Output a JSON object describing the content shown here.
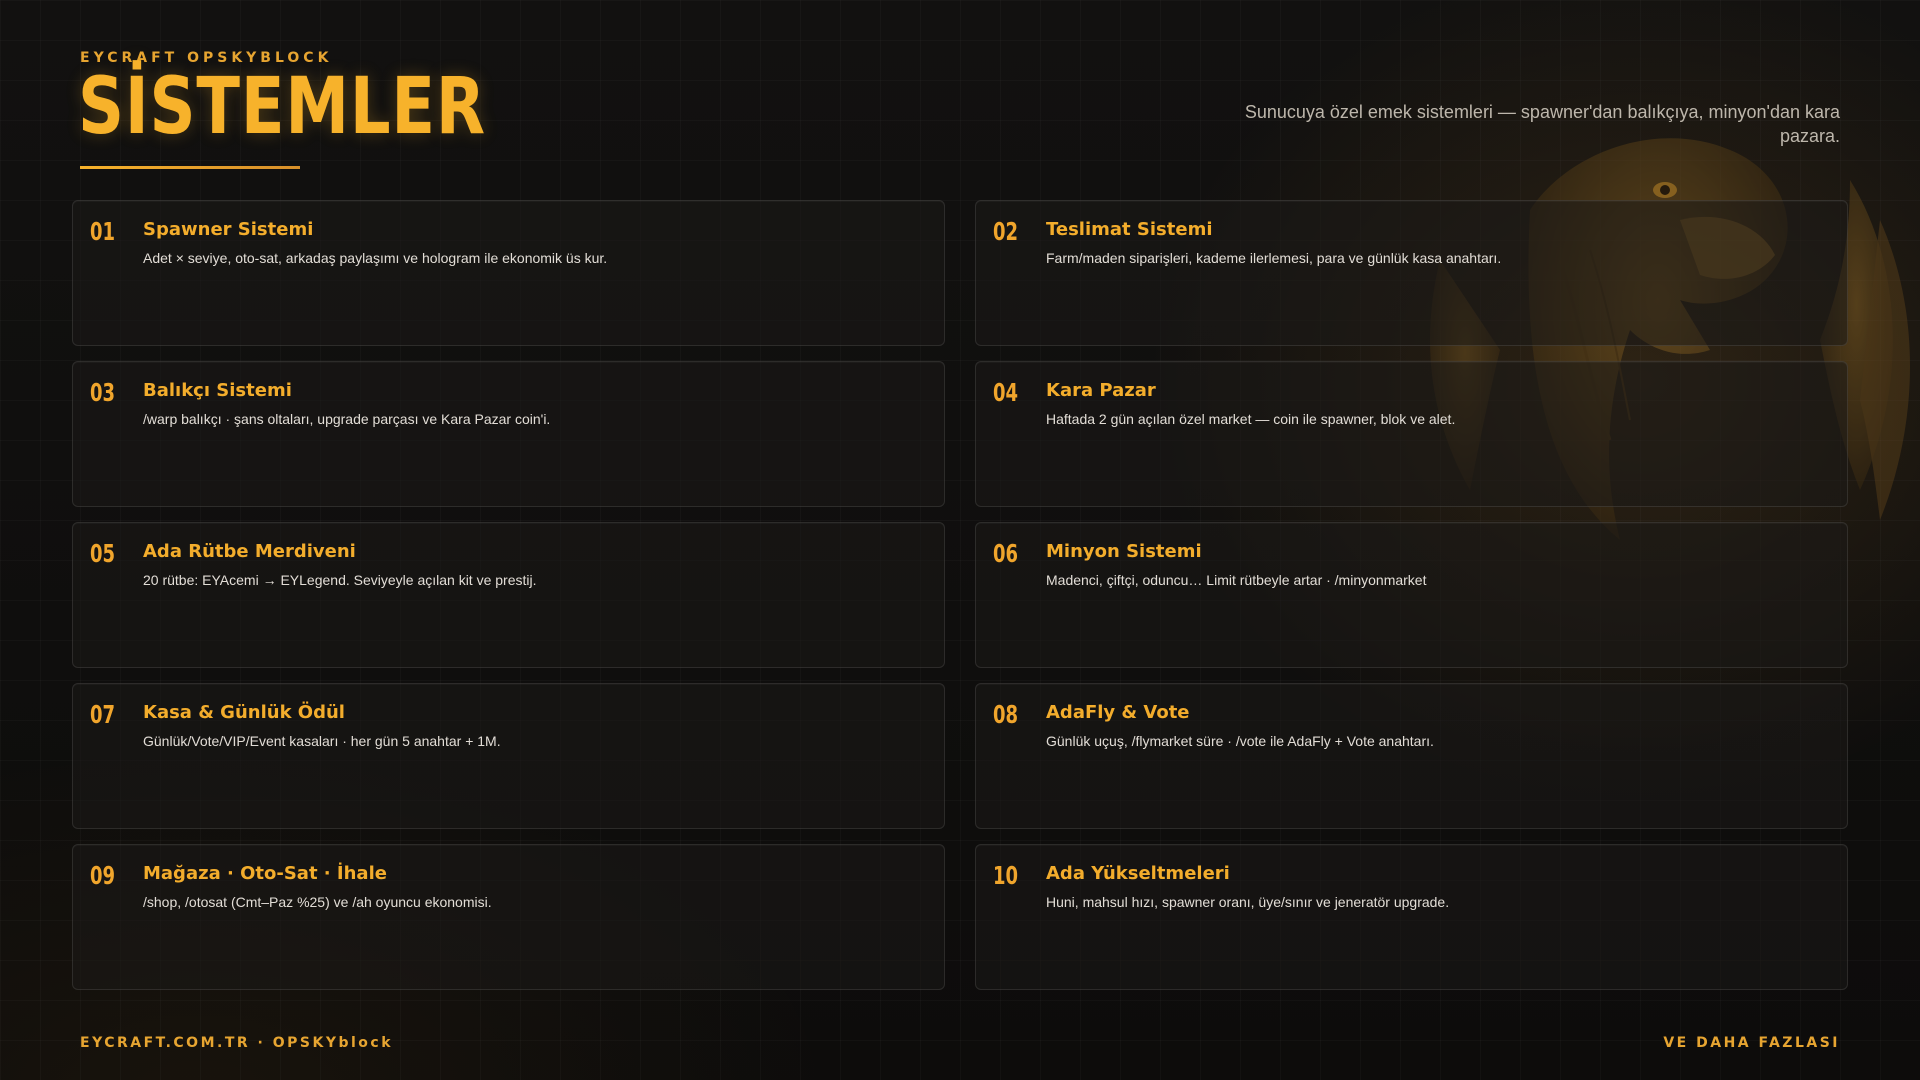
{
  "header": {
    "brand": "EYCRAFT OPSKYBLOCK",
    "title": "SİSTEMLER",
    "subtitle": "Sunucuya özel emek sistemleri — spawner'dan balıkçıya, minyon'dan kara pazara."
  },
  "cards": [
    {
      "num": "01",
      "title": "Spawner Sistemi",
      "desc": "Adet × seviye, oto-sat, arkadaş paylaşımı ve hologram ile ekonomik üs kur."
    },
    {
      "num": "02",
      "title": "Teslimat Sistemi",
      "desc": "Farm/maden siparişleri, kademe ilerlemesi, para ve günlük kasa anahtarı."
    },
    {
      "num": "03",
      "title": "Balıkçı Sistemi",
      "desc": "/warp balıkçı · şans oltaları, upgrade parçası ve Kara Pazar coin'i."
    },
    {
      "num": "04",
      "title": "Kara Pazar",
      "desc": "Haftada 2 gün açılan özel market — coin ile spawner, blok ve alet."
    },
    {
      "num": "05",
      "title": "Ada Rütbe Merdiveni",
      "desc": "20 rütbe: EYAcemi → EYLegend. Seviyeyle açılan kit ve prestij."
    },
    {
      "num": "06",
      "title": "Minyon Sistemi",
      "desc": "Madenci, çiftçi, oduncu… Limit rütbeyle artar · /minyonmarket"
    },
    {
      "num": "07",
      "title": "Kasa & Günlük Ödül",
      "desc": "Günlük/Vote/VIP/Event kasaları · her gün 5 anahtar + 1M."
    },
    {
      "num": "08",
      "title": "AdaFly & Vote",
      "desc": "Günlük uçuş, /flymarket süre · /vote ile AdaFly + Vote anahtarı."
    },
    {
      "num": "09",
      "title": "Mağaza · Oto-Sat · İhale",
      "desc": "/shop, /otosat (Cmt–Paz %25) ve /ah oyuncu ekonomisi."
    },
    {
      "num": "10",
      "title": "Ada Yükseltmeleri",
      "desc": "Huni, mahsul hızı, spawner oranı, üye/sınır ve jeneratör upgrade."
    }
  ],
  "footer": {
    "left": "EYCRAFT.COM.TR · OPSKYblock",
    "right": "VE DAHA FAZLASI"
  },
  "colors": {
    "accent": "#f7b22b",
    "background": "#0e0d0c",
    "text": "#e2ddd6"
  },
  "icons": {
    "background_emblem": "eagle-emblem"
  }
}
